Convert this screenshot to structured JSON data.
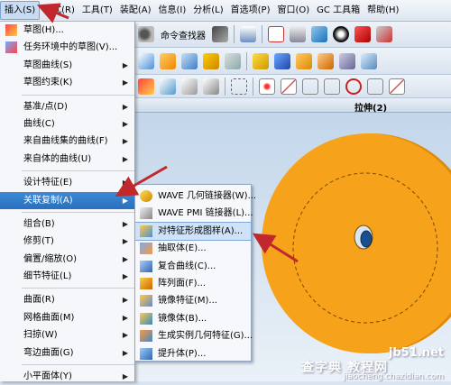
{
  "menubar": {
    "items": [
      "插入(S)",
      "格式(R)",
      "工具(T)",
      "装配(A)",
      "信息(I)",
      "分析(L)",
      "首选项(P)",
      "窗口(O)",
      "GC 工具箱",
      "帮助(H)"
    ]
  },
  "toolbar": {
    "command_finder": "命令查找器"
  },
  "graphics_title": "拉伸(2)",
  "insert_menu": {
    "items": [
      {
        "label": "草图(H)...",
        "arrow": false
      },
      {
        "label": "任务环境中的草图(V)...",
        "arrow": false
      },
      {
        "label": "草图曲线(S)",
        "arrow": true
      },
      {
        "label": "草图约束(K)",
        "arrow": true
      },
      {
        "label": "基准/点(D)",
        "arrow": true
      },
      {
        "label": "曲线(C)",
        "arrow": true
      },
      {
        "label": "来自曲线集的曲线(F)",
        "arrow": true
      },
      {
        "label": "来自体的曲线(U)",
        "arrow": true
      },
      {
        "label": "设计特征(E)",
        "arrow": true
      },
      {
        "label": "关联复制(A)",
        "arrow": true
      },
      {
        "label": "组合(B)",
        "arrow": true
      },
      {
        "label": "修剪(T)",
        "arrow": true
      },
      {
        "label": "偏置/缩放(O)",
        "arrow": true
      },
      {
        "label": "细节特征(L)",
        "arrow": true
      },
      {
        "label": "曲面(R)",
        "arrow": true
      },
      {
        "label": "网格曲面(M)",
        "arrow": true
      },
      {
        "label": "扫掠(W)",
        "arrow": true
      },
      {
        "label": "弯边曲面(G)",
        "arrow": true
      },
      {
        "label": "小平面体(Y)",
        "arrow": true
      }
    ]
  },
  "submenu": {
    "items": [
      "WAVE 几何链接器(W)...",
      "WAVE PMI 链接器(L)...",
      "对特征形成图样(A)...",
      "抽取体(E)...",
      "复合曲线(C)...",
      "阵列面(F)...",
      "镜像特征(M)...",
      "镜像体(B)...",
      "生成实例几何特征(G)...",
      "提升体(P)..."
    ]
  },
  "watermark": {
    "line1": "jb51.net",
    "line2": "查字典 教程网",
    "line3": "jiaocheng.chazidian.com"
  },
  "colors": {
    "part": "#f7a21b",
    "highlight": "#2f78c8",
    "arrow": "#c0282e"
  }
}
